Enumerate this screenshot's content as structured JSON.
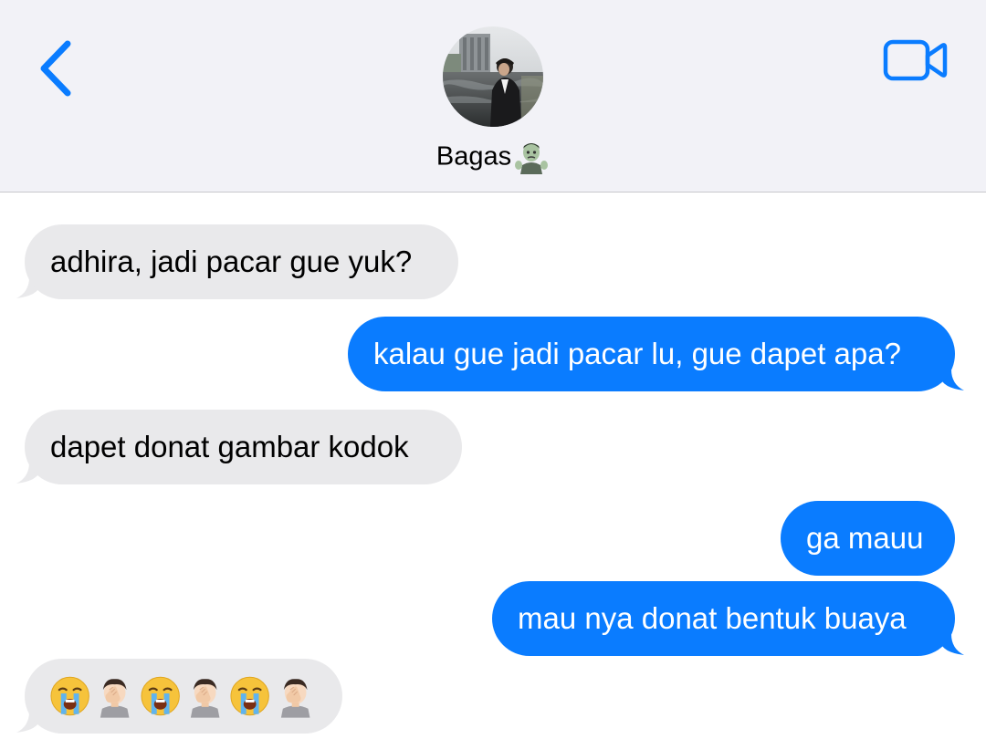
{
  "header": {
    "contact_name": "Bagas",
    "back_icon": "chevron-left-icon",
    "video_icon": "video-camera-icon",
    "contact_emoji": "zombie-emoji",
    "accent_color": "#0a7cff"
  },
  "messages": [
    {
      "direction": "incoming",
      "text": "adhira, jadi pacar gue yuk?"
    },
    {
      "direction": "outgoing",
      "text": "kalau gue jadi pacar lu, gue dapet apa?"
    },
    {
      "direction": "incoming",
      "text": "dapet donat gambar kodok"
    },
    {
      "direction": "outgoing",
      "text": "ga mauu"
    },
    {
      "direction": "outgoing",
      "text": "mau nya donat bentuk buaya"
    },
    {
      "direction": "incoming",
      "emojis": [
        "loudly-crying-face",
        "man-facepalming",
        "loudly-crying-face",
        "man-facepalming",
        "loudly-crying-face",
        "man-facepalming"
      ]
    }
  ],
  "colors": {
    "incoming_bubble": "#e9e9eb",
    "outgoing_bubble": "#0a7cff",
    "header_bg": "#f2f2f7"
  }
}
